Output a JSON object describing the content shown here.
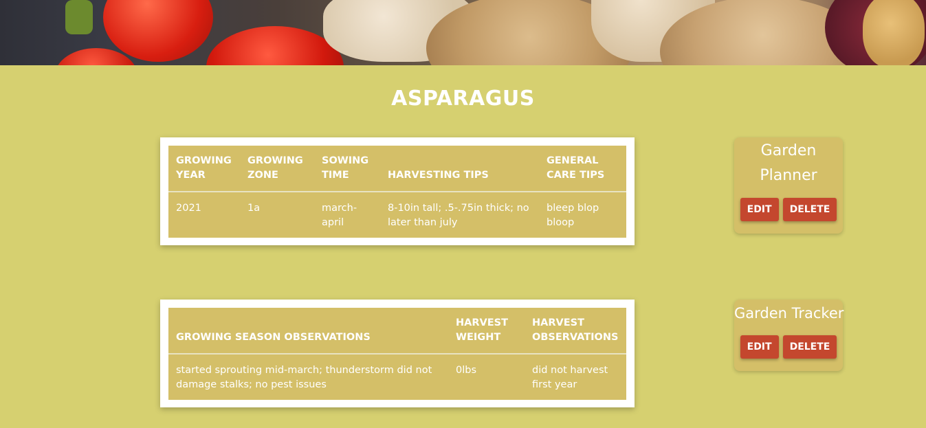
{
  "page": {
    "title": "ASPARAGUS"
  },
  "planting_table": {
    "headers": [
      "GROWING YEAR",
      "GROWING ZONE",
      "SOWING TIME",
      "HARVESTING TIPS",
      "GENERAL CARE TIPS"
    ],
    "row": [
      "2021",
      "1a",
      "march-april",
      "8-10in tall; .5-.75in thick; no later than july",
      "bleep blop bloop"
    ]
  },
  "tracker_table": {
    "headers": [
      "GROWING SEASON OBSERVATIONS",
      "HARVEST WEIGHT",
      "HARVEST OBSERVATIONS"
    ],
    "row": [
      "started sprouting mid-march; thunderstorm did not damage stalks; no pest issues",
      "0lbs",
      "did not harvest first year"
    ]
  },
  "planner_panel": {
    "title": "Garden Planner",
    "edit_label": "EDIT",
    "delete_label": "DELETE"
  },
  "tracker_panel": {
    "title": "Garden Tracker",
    "edit_label": "EDIT",
    "delete_label": "DELETE"
  },
  "colors": {
    "background": "#d6d070",
    "table": "#d4bf68",
    "button": "#c4472e"
  }
}
